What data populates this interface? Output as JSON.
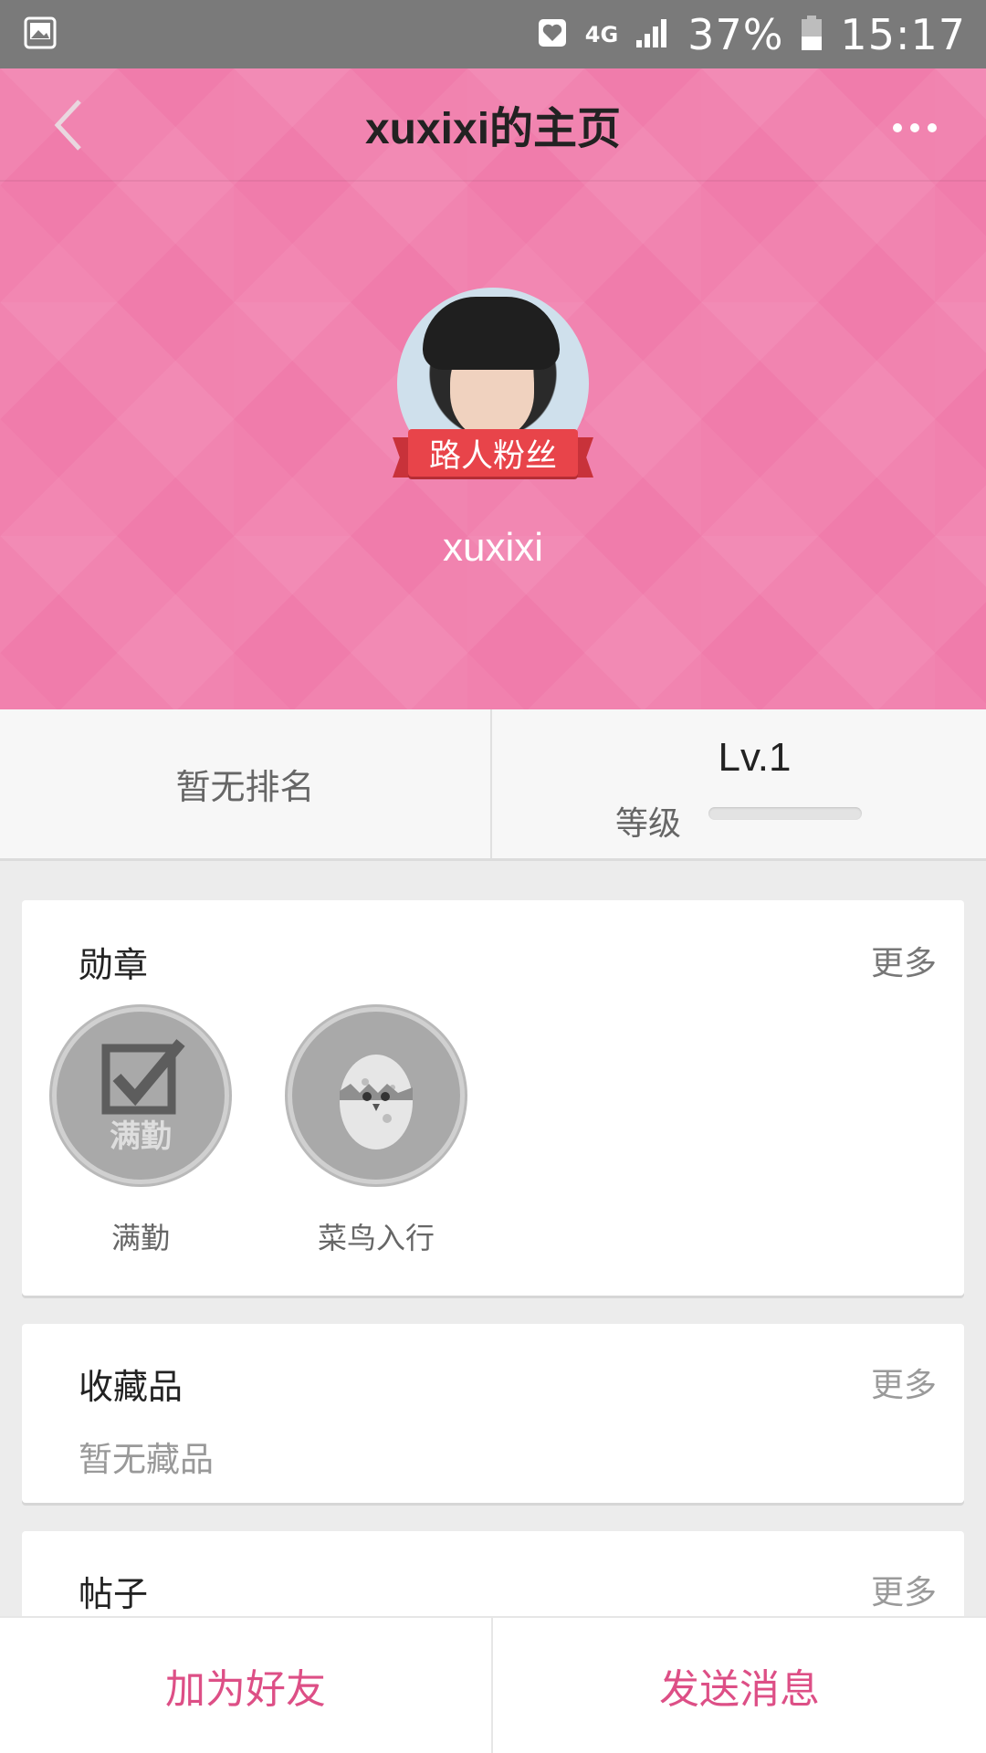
{
  "status_bar": {
    "network": "4G",
    "battery": "37%",
    "time": "15:17"
  },
  "colors": {
    "header_pink": "#f07cab",
    "accent_pink": "#dd4f86",
    "ribbon_red": "#e8444a"
  },
  "icons": {
    "back": "chevron-left-icon",
    "more": "more-dots-icon",
    "gallery": "image-icon",
    "heart": "heart-icon",
    "signal": "signal-icon",
    "battery": "battery-icon"
  },
  "header": {
    "title": "xuxixi的主页",
    "username": "xuxixi",
    "fan_badge": "路人粉丝"
  },
  "stats": {
    "rank_text": "暂无排名",
    "level_value": "Lv.1",
    "level_label": "等级",
    "level_progress": 0
  },
  "medals": {
    "title": "勋章",
    "more": "更多",
    "items": [
      {
        "label": "满勤",
        "badge_text": "满勤",
        "icon": "checkbox-medal-icon"
      },
      {
        "label": "菜鸟入行",
        "icon": "egg-chick-medal-icon"
      }
    ]
  },
  "collection": {
    "title": "收藏品",
    "more": "更多",
    "empty_text": "暂无藏品"
  },
  "posts": {
    "title": "帖子",
    "more": "更多"
  },
  "actions": {
    "add_friend": "加为好友",
    "send_message": "发送消息"
  }
}
